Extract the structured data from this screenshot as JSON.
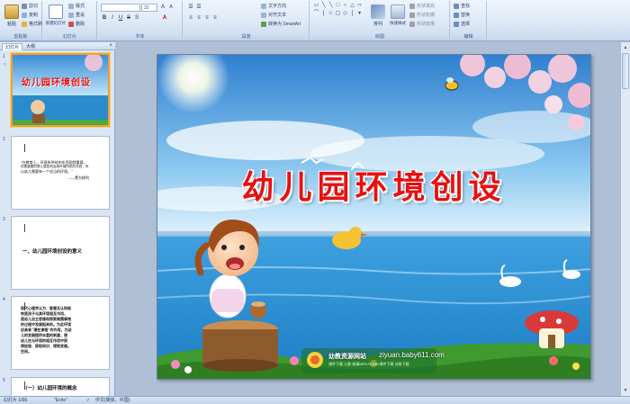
{
  "ribbon": {
    "groups": {
      "clipboard": "剪贴板",
      "slides": "幻灯片",
      "font": "字体",
      "paragraph": "段落",
      "drawing": "绘图",
      "editing": "编辑"
    },
    "paste": "粘贴",
    "cut": "剪切",
    "copy": "复制",
    "format_painter": "格式刷",
    "new_slide": "新建幻灯片",
    "layout": "版式",
    "reset": "重设",
    "delete": "删除",
    "font_size": "32",
    "text_direction": "文字方向",
    "align_text": "对齐文本",
    "convert_smartart": "转换为 SmartArt",
    "arrange": "排列",
    "quick_styles": "快速样式",
    "shape_fill": "形状填充",
    "shape_outline": "形状轮廓",
    "shape_effects": "形状效果",
    "find": "查找",
    "replace": "替换",
    "select": "选择"
  },
  "panel": {
    "tab_slides": "幻灯片",
    "tab_outline": "大纲",
    "close": "×",
    "thumbs": [
      {
        "num": "1",
        "title": "幼儿园环境创设"
      },
      {
        "num": "2",
        "quote_l1": "\"在教育上，环境所供给的东西固然重要，",
        "quote_l2": "但更重要的是儿童如何运用环境所供的东西，所",
        "quote_l3": "以幼儿需要有一个适当的环境。\"",
        "quote_author": "——蒙台梭利"
      },
      {
        "num": "3",
        "heading": "一、幼儿园环境创设的意义"
      },
      {
        "num": "4",
        "p_l1": "现代心理学认为：智慧及认知结",
        "p_l2": "构是孩子与其环境相互作用，",
        "p_l3": "是幼儿自主思维和探索周围事物",
        "p_l4": "的过程中发展起来的。为此环境",
        "p_l5": "应具有\"潜在课程\"的作用，为幼",
        "p_l6": "儿的发展提供丰富的刺激，使",
        "p_l7": "幼儿在与环境的相互作用中获",
        "p_l8": "得经验、获取知识、得到发展。",
        "p_l9": "空间。"
      },
      {
        "num": "5",
        "heading": "（一）幼儿园环境的概念"
      }
    ]
  },
  "slide": {
    "title": "幼儿园环境创设",
    "brand_name": "幼教资源网站",
    "brand_url": "ziyuan.baby611.com",
    "brand_tags": "课件下载  儿歌  故事MP3  FLASH课件下载  试卷下载"
  },
  "status": {
    "slide_pos": "幻灯片 1/66",
    "theme": "\"Echo\"",
    "language": "中文(简体，中国)"
  },
  "colors": {
    "title_red": "#e81010",
    "ribbon_bg": "#dde8f6",
    "selected_border": "#f0a030"
  }
}
